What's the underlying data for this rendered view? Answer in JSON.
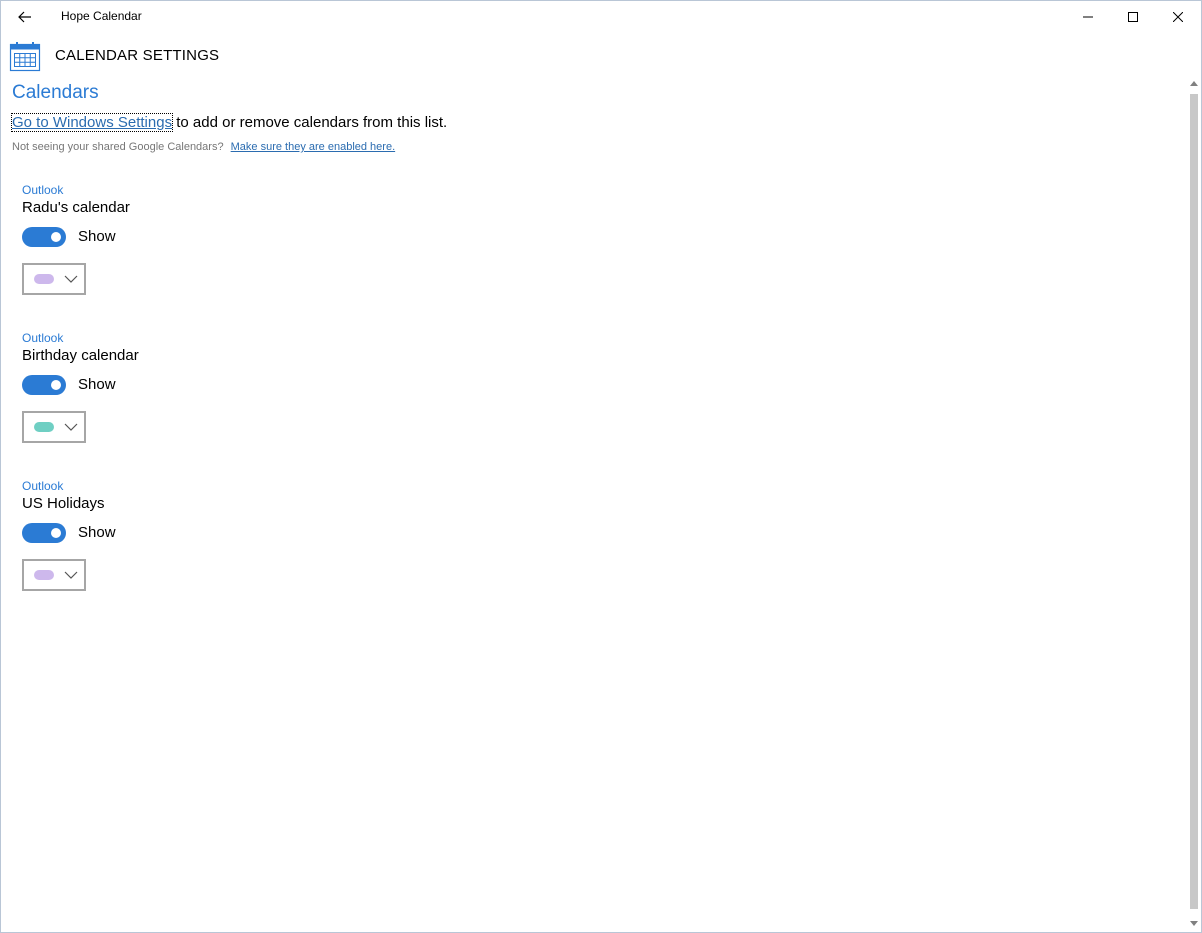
{
  "window": {
    "title": "Hope Calendar"
  },
  "icons": {
    "back": "back-arrow-icon",
    "minimize": "minimize-icon",
    "maximize": "maximize-icon",
    "close": "close-icon",
    "header": "calendar-icon",
    "dropdown": "chevron-down-icon"
  },
  "header": {
    "title": "CALENDAR SETTINGS"
  },
  "section": {
    "title": "Calendars",
    "settings_link": "Go to Windows Settings",
    "settings_suffix": " to add or remove calendars from this list.",
    "google_text": "Not seeing your shared Google Calendars?",
    "google_link": "Make sure they are enabled here."
  },
  "colors": {
    "accent": "#2b7bd4",
    "link": "#2b6cb0"
  },
  "calendars": [
    {
      "provider": "Outlook",
      "name": "Radu's calendar",
      "toggle_label": "Show",
      "toggle_on": true,
      "color": "#cdb8ec"
    },
    {
      "provider": "Outlook",
      "name": "Birthday calendar",
      "toggle_label": "Show",
      "toggle_on": true,
      "color": "#6fcfc3"
    },
    {
      "provider": "Outlook",
      "name": "US Holidays",
      "toggle_label": "Show",
      "toggle_on": true,
      "color": "#cdb8ec"
    }
  ]
}
